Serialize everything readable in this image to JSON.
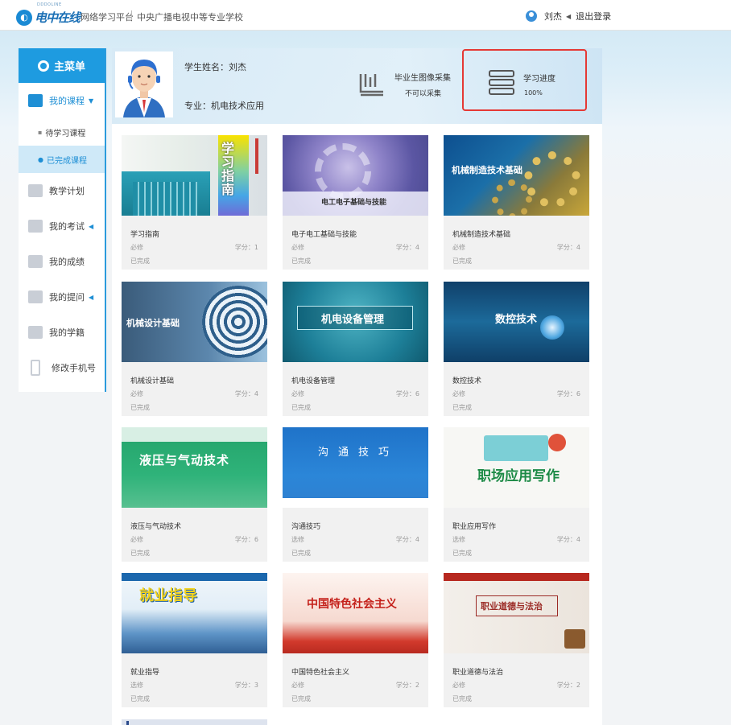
{
  "header": {
    "logo_text": "电中在线",
    "logo_sub": "DDDOLINE",
    "platform": "网络学习平台",
    "school": "中央广播电视中等专业学校",
    "user_name": "刘杰",
    "logout": "退出登录"
  },
  "sidebar": {
    "title": "主菜单",
    "my_courses": "我的课程",
    "sub_pending": "待学习课程",
    "sub_done": "已完成课程",
    "items": [
      "教学计划",
      "我的考试",
      "我的成绩",
      "我的提问",
      "我的学籍",
      "修改手机号"
    ]
  },
  "profile": {
    "name_label": "学生姓名：刘杰",
    "major_label": "专业：机电技术应用",
    "grad_title": "毕业生图像采集",
    "grad_value": "不可以采集",
    "progress_title": "学习进度",
    "progress_value": "100%"
  },
  "courses": [
    {
      "name": "学习指南",
      "type": "必修",
      "credit": "学分：1",
      "status": "已完成",
      "thumb_text": "学习指南"
    },
    {
      "name": "电子电工基础与技能",
      "type": "必修",
      "credit": "学分：4",
      "status": "已完成",
      "thumb_text": "电工电子基础与技能"
    },
    {
      "name": "机械制造技术基础",
      "type": "必修",
      "credit": "学分：4",
      "status": "已完成",
      "thumb_text": "机械制造技术基础"
    },
    {
      "name": "机械设计基础",
      "type": "必修",
      "credit": "学分：4",
      "status": "已完成",
      "thumb_text": "机械设计基础"
    },
    {
      "name": "机电设备管理",
      "type": "必修",
      "credit": "学分：6",
      "status": "已完成",
      "thumb_text": "机电设备管理"
    },
    {
      "name": "数控技术",
      "type": "必修",
      "credit": "学分：6",
      "status": "已完成",
      "thumb_text": "数控技术"
    },
    {
      "name": "液压与气动技术",
      "type": "必修",
      "credit": "学分：6",
      "status": "已完成",
      "thumb_text": "液压与气动技术"
    },
    {
      "name": "沟通技巧",
      "type": "选修",
      "credit": "学分：4",
      "status": "已完成",
      "thumb_text": "沟通技巧"
    },
    {
      "name": "职业应用写作",
      "type": "选修",
      "credit": "学分：4",
      "status": "已完成",
      "thumb_text": "职场应用写作"
    },
    {
      "name": "就业指导",
      "type": "选修",
      "credit": "学分：3",
      "status": "已完成",
      "thumb_text": "就业指导"
    },
    {
      "name": "中国特色社会主义",
      "type": "必修",
      "credit": "学分：2",
      "status": "已完成",
      "thumb_text": "中国特色社会主义"
    },
    {
      "name": "职业道德与法治",
      "type": "必修",
      "credit": "学分：2",
      "status": "已完成",
      "thumb_text": "职业道德与法治"
    }
  ]
}
